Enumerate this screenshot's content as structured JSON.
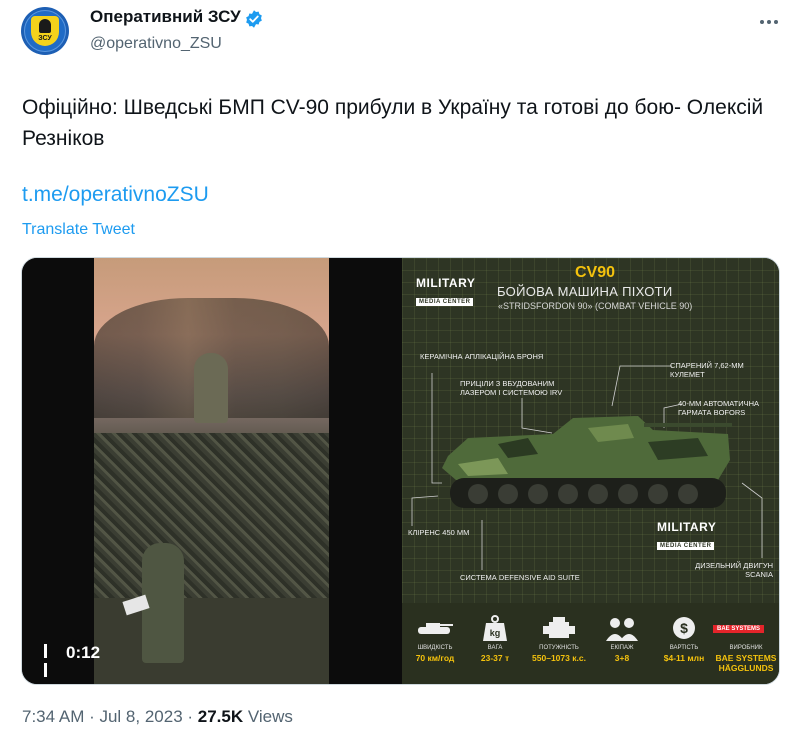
{
  "author": {
    "name": "Оперативний ЗСУ",
    "handle": "@operativno_ZSU",
    "avatar_text": "ЗСУ"
  },
  "tweet": {
    "text": "Офіційно: Шведські БМП CV-90 прибули в Україну та готові до бою- Олексій Резніков",
    "link": "t.me/operativnoZSU",
    "translate_label": "Translate Tweet"
  },
  "video": {
    "timecode": "0:12"
  },
  "infographic": {
    "brand": "MILITARY",
    "brand_sub": "MEDIA CENTER",
    "title": "CV90",
    "subtitle": "БОЙОВА МАШИНА ПІХОТИ",
    "subtitle2": "«STRIDSFORDON 90» (COMBAT VEHICLE 90)",
    "labels": {
      "armor": "КЕРАМІЧНА АПЛІКАЦІЙНА БРОНЯ",
      "sights": "ПРИЦІЛИ З ВБУДОВАНИМ ЛАЗЕРОМ І СИСТЕМОЮ IRV",
      "mg": "СПАРЕНИЙ 7,62-ММ КУЛЕМЕТ",
      "gun": "40-ММ АВТОМАТИЧНА ГАРМАТА BOFORS",
      "clearance": "КЛІРЕНС 450 ММ",
      "engine": "ДИЗЕЛЬНИЙ ДВИГУН SCANIA",
      "defense": "СИСТЕМА DEFENSIVE AID SUITE"
    },
    "stats": [
      {
        "label": "ШВИДКІСТЬ",
        "value": "70 км/год",
        "icon": "tank-icon"
      },
      {
        "label": "ВАГА",
        "value": "23-37 т",
        "icon": "weight-icon"
      },
      {
        "label": "ПОТУЖНІСТЬ",
        "value": "550–1073 к.с.",
        "icon": "engine-icon"
      },
      {
        "label": "ЕКІПАЖ",
        "value": "3+8",
        "icon": "crew-icon"
      },
      {
        "label": "ВАРТІСТЬ",
        "value": "$4-11 млн",
        "icon": "dollar-icon"
      },
      {
        "label": "ВИРОБНИК",
        "value": "BAE SYSTEMS HÄGGLUNDS",
        "icon": "bae-logo"
      }
    ],
    "bae_logo": "BAE SYSTEMS"
  },
  "footer": {
    "time": "7:34 AM · Jul 8, 2023 · ",
    "views_count": "27.5K",
    "views_label": " Views"
  },
  "colors": {
    "accent": "#1d9bf0",
    "verified": "#1d9bf0",
    "highlight": "#f4c20d"
  }
}
